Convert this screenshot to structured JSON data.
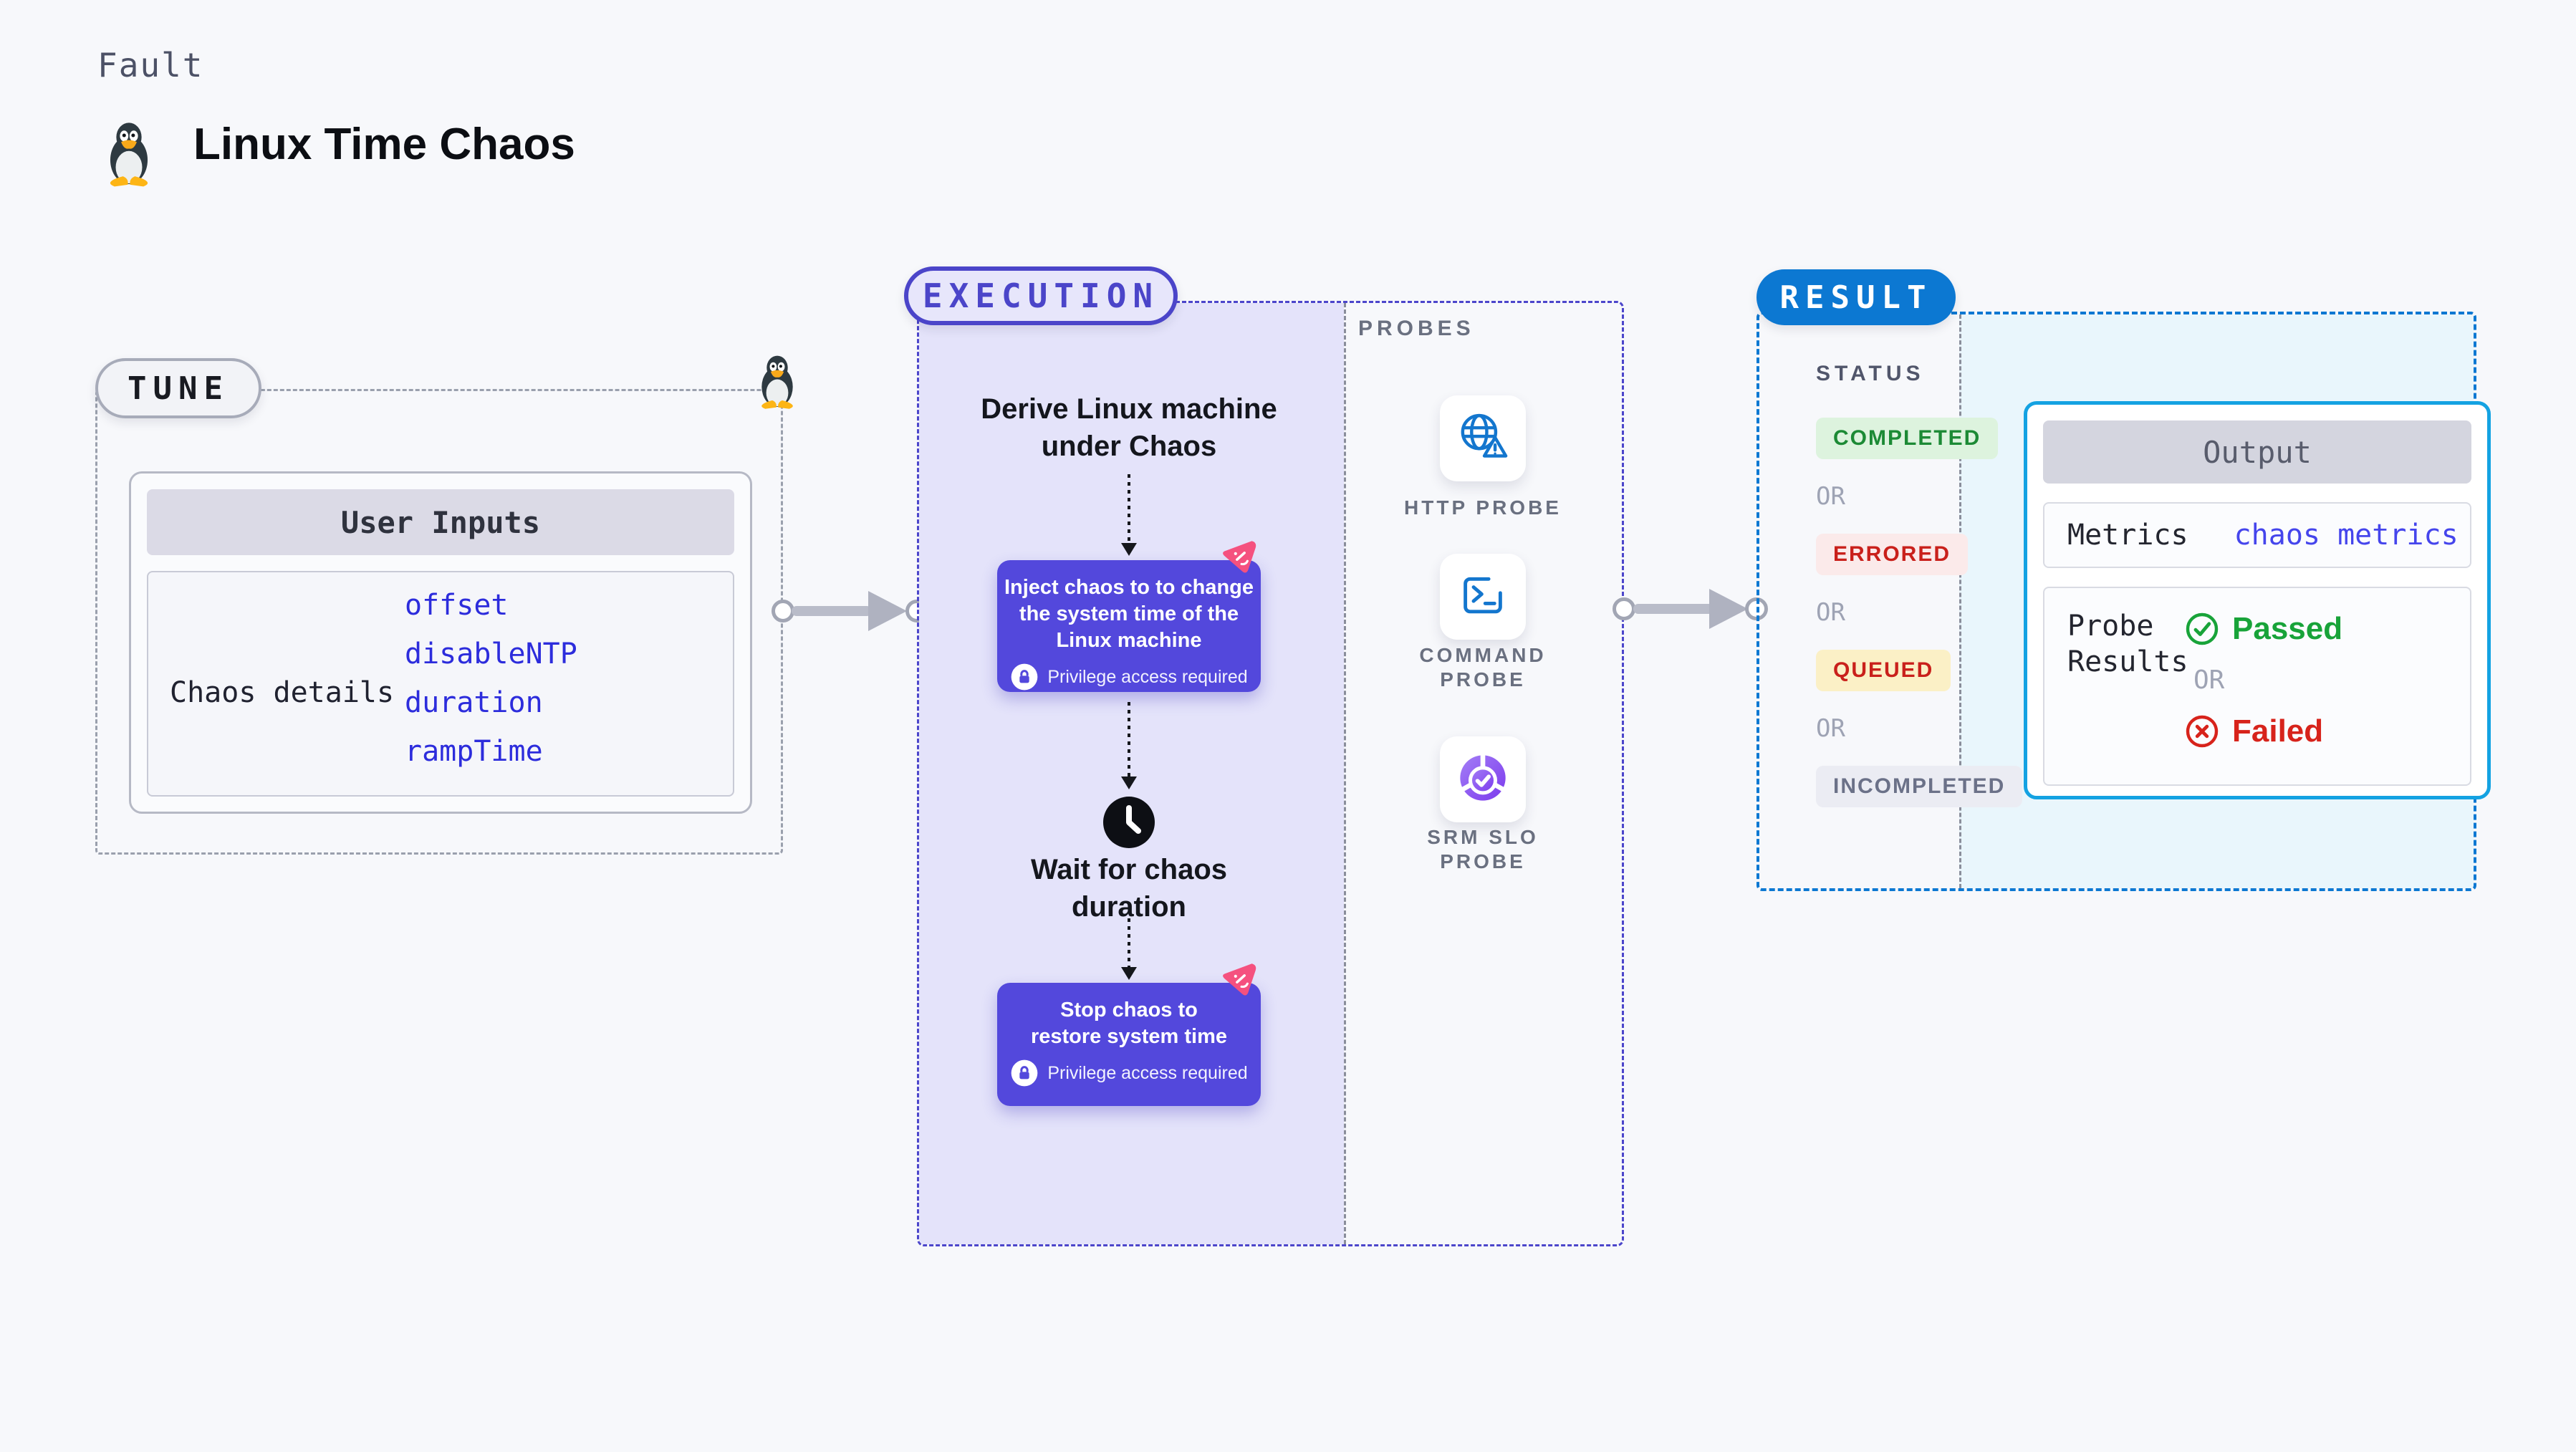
{
  "header": {
    "fault_label": "Fault",
    "title": "Linux Time Chaos"
  },
  "tune": {
    "pill": "TUNE",
    "user_inputs_header": "User Inputs",
    "row_label": "Chaos details",
    "inputs": [
      "offset",
      "disableNTP",
      "duration",
      "rampTime"
    ]
  },
  "execution": {
    "pill": "EXECUTION",
    "derive_text": "Derive Linux machine\nunder Chaos",
    "inject_text": "Inject chaos to to change\nthe system time of the\nLinux machine",
    "wait_text": "Wait for chaos\nduration",
    "stop_text": "Stop chaos to\nrestore system time",
    "privilege_badge": "Privilege access required"
  },
  "probes": {
    "label": "PROBES",
    "items": [
      {
        "name": "HTTP PROBE"
      },
      {
        "name": "COMMAND\nPROBE"
      },
      {
        "name": "SRM SLO\nPROBE"
      }
    ]
  },
  "result": {
    "pill": "RESULT",
    "status_label": "STATUS",
    "or": "OR",
    "statuses": [
      {
        "label": "COMPLETED"
      },
      {
        "label": "ERRORED"
      },
      {
        "label": "QUEUED"
      },
      {
        "label": "INCOMPLETED"
      }
    ],
    "output": {
      "header": "Output",
      "metrics_label": "Metrics",
      "metrics_value": "chaos metrics",
      "probe_results_label": "Probe\nResults",
      "passed": "Passed",
      "or": "OR",
      "failed": "Failed"
    }
  },
  "colors": {
    "accent_indigo": "#4B45C9",
    "purple_box": "#5348DC",
    "result_blue": "#0C78D2",
    "probe_icon_blue": "#1376CE",
    "passed_green": "#18A339",
    "failed_red": "#D7231B",
    "link_blue": "#2C2CDC",
    "pink_chaos": "#F5517F",
    "lavender_bg": "#E4E3FA",
    "lightblue_bg": "#E9F6FC"
  }
}
